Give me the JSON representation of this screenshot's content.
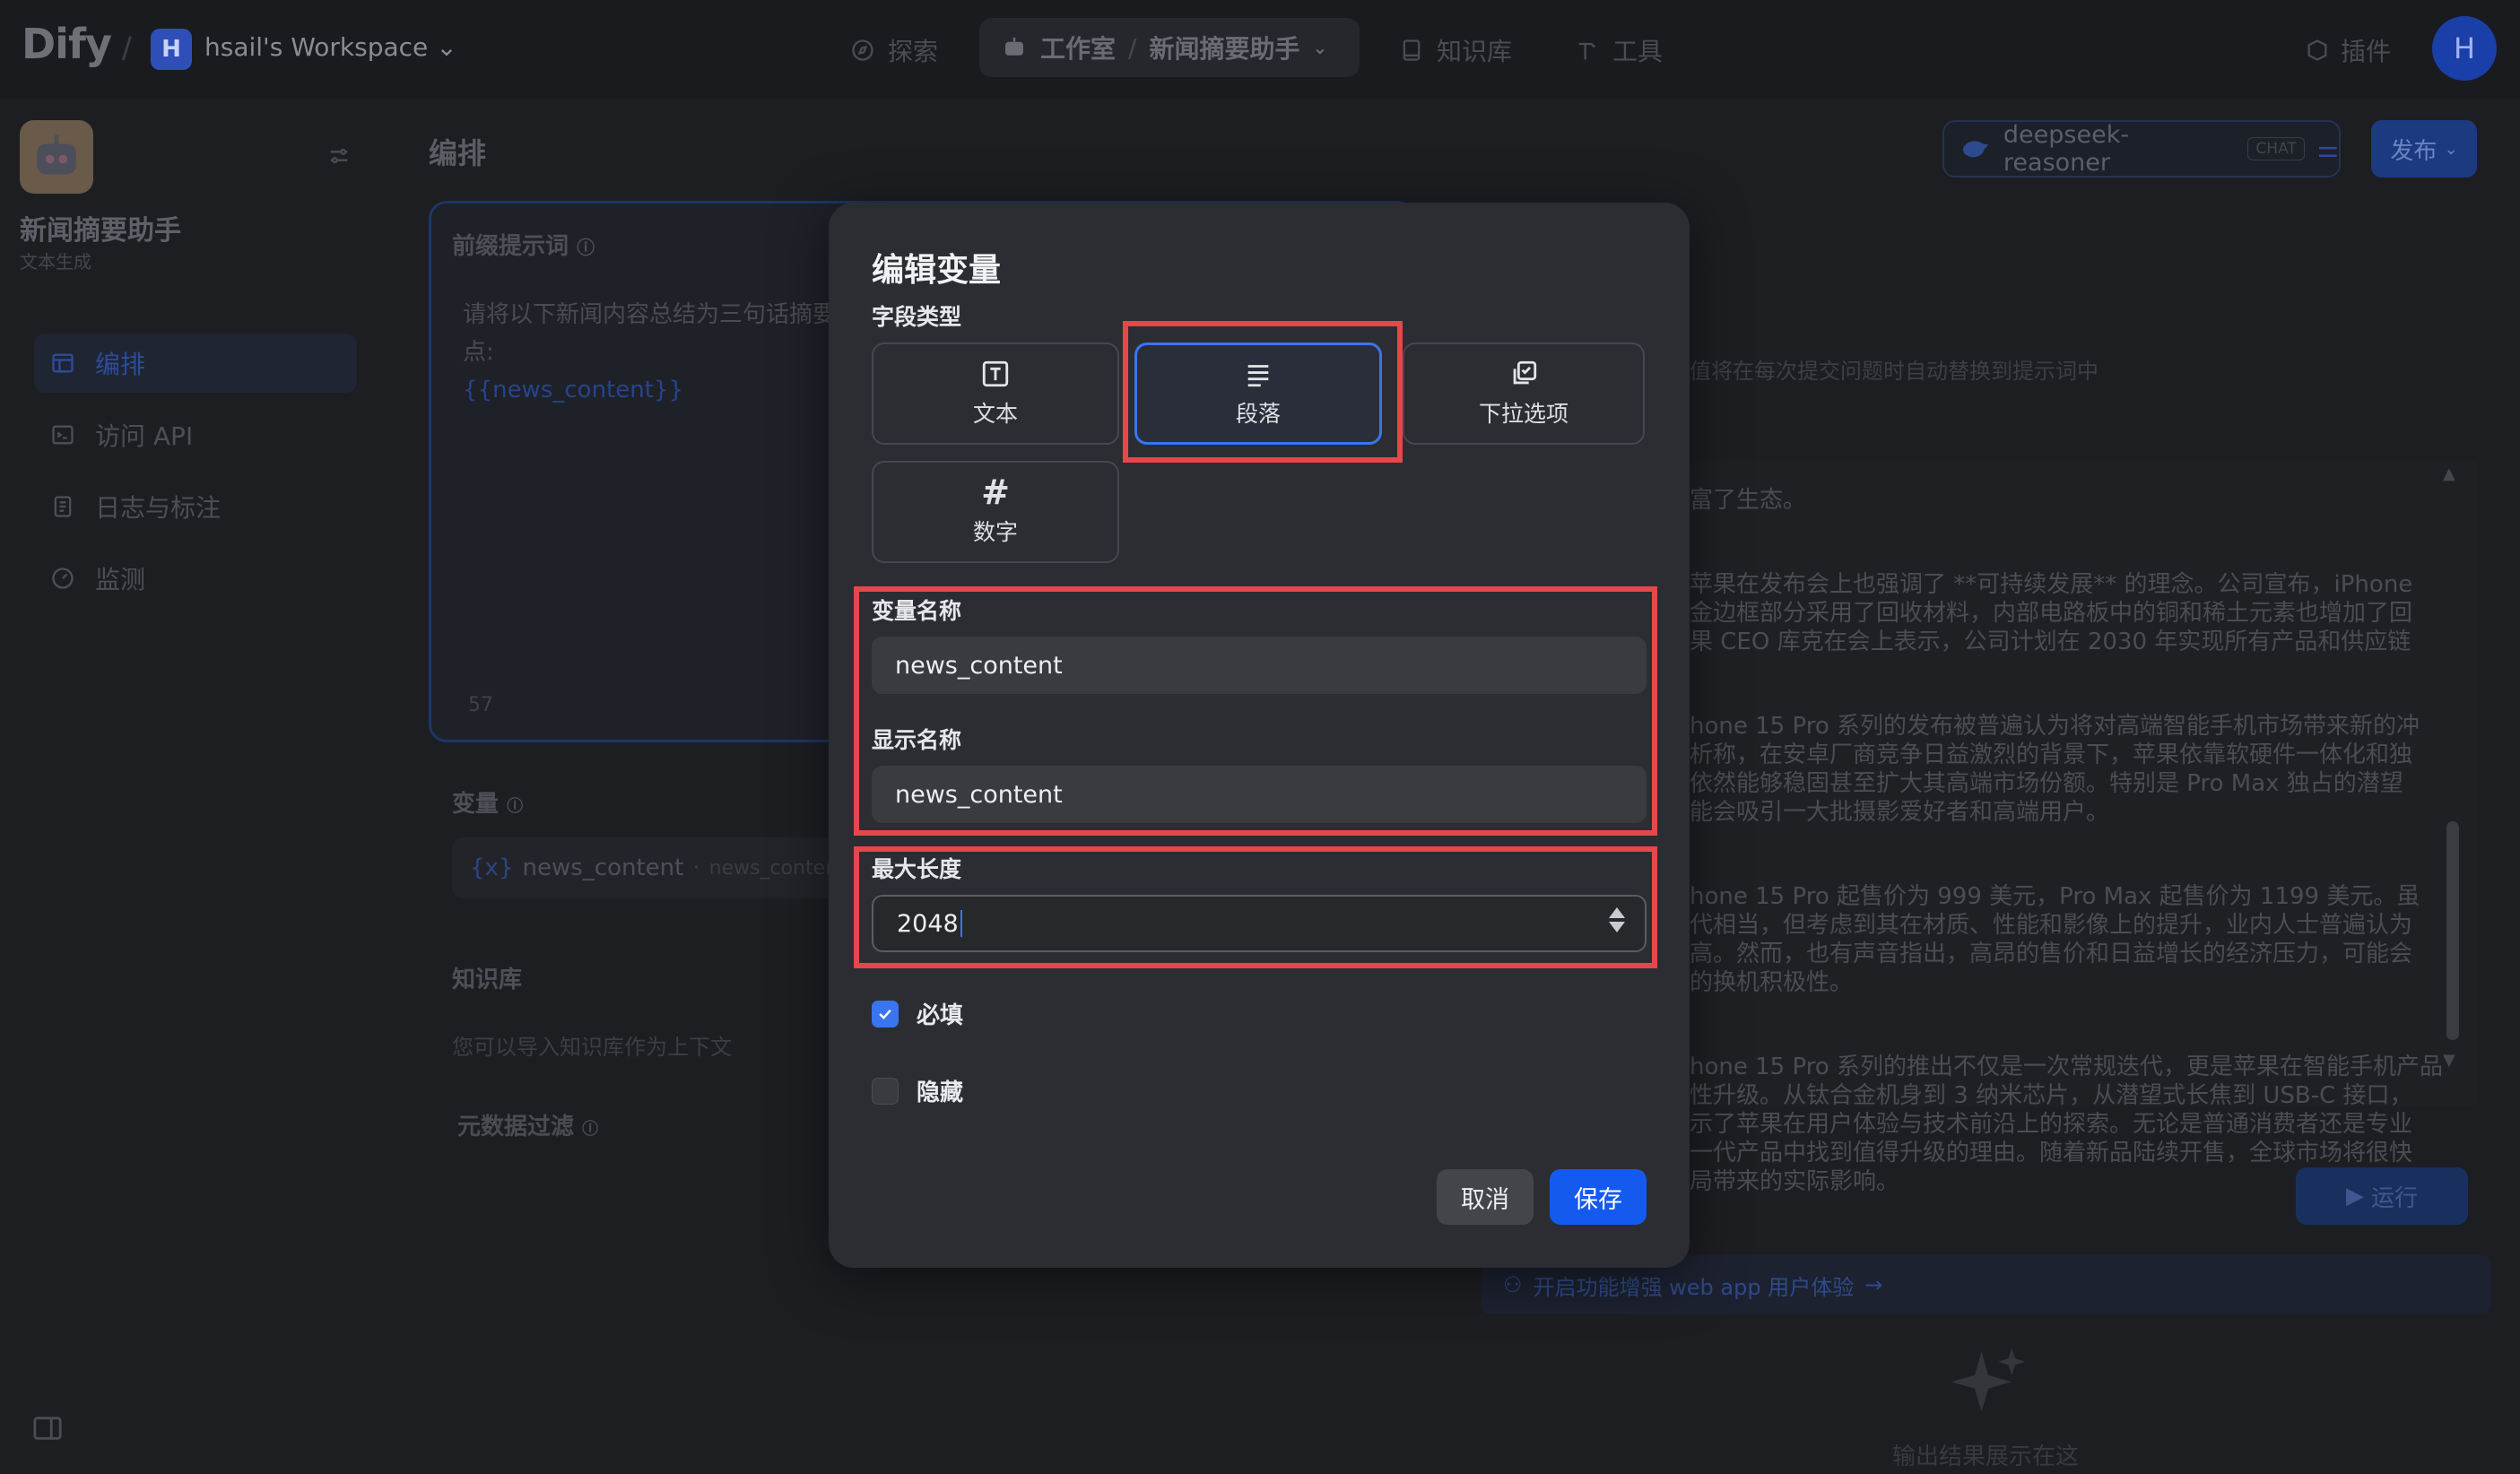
{
  "topbar": {
    "logo": "Dify",
    "workspace_initial": "H",
    "workspace_name": "hsail's Workspace",
    "nav_explore": "探索",
    "nav_studio": "工作室",
    "nav_app": "新闻摘要助手",
    "nav_knowledge": "知识库",
    "nav_tools": "工具",
    "nav_plugins": "插件",
    "user_initial": "H"
  },
  "sidebar": {
    "app_name": "新闻摘要助手",
    "app_type": "文本生成",
    "items": [
      {
        "label": "编排",
        "active": true
      },
      {
        "label": "访问 API"
      },
      {
        "label": "日志与标注"
      },
      {
        "label": "监测"
      }
    ]
  },
  "main": {
    "section_title": "编排",
    "prompt_header": "前缀提示词",
    "prompt_line1": "请将以下新闻内容总结为三句话摘要",
    "prompt_line2": "点:",
    "prompt_var": "{{news_content}}",
    "char_count": "57",
    "variables_header": "变量",
    "variable_key": "news_content",
    "variable_name": "news_content",
    "knowledge_header": "知识库",
    "knowledge_desc": "您可以导入知识库作为上下文",
    "metadata_header": "元数据过滤"
  },
  "right": {
    "model_name": "deepseek-reasoner",
    "model_tag": "CHAT",
    "publish_label": "发布",
    "var_hint": "值将在每次提交问题时自动替换到提示词中",
    "news_paragraphs": [
      "富了生态。",
      "苹果在发布会上也强调了 **可持续发展** 的理念。公司宣布，iPhone\n金边框部分采用了回收材料，内部电路板中的铜和稀土元素也增加了回\n果 CEO 库克在会上表示，公司计划在 2030 年实现所有产品和供应链",
      "hone 15 Pro 系列的发布被普遍认为将对高端智能手机市场带来新的冲\n析称，在安卓厂商竞争日益激烈的背景下，苹果依靠软硬件一体化和独\n依然能够稳固甚至扩大其高端市场份额。特别是 Pro Max 独占的潜望\n能会吸引一大批摄影爱好者和高端用户。",
      "hone 15 Pro 起售价为 999 美元，Pro Max 起售价为 1199 美元。虽\n代相当，但考虑到其在材质、性能和影像上的提升，业内人士普遍认为\n高。然而，也有声音指出，高昂的售价和日益增长的经济压力，可能会\n的换机积极性。",
      "hone 15 Pro 系列的推出不仅是一次常规迭代，更是苹果在智能手机产品\n性升级。从钛合金机身到 3 纳米芯片，从潜望式长焦到 USB-C 接口，\n示了苹果在用户体验与技术前沿上的探索。无论是普通消费者还是专业\n一代产品中找到值得升级的理由。随着新品陆续开售，全球市场将很快\n局带来的实际影响。"
    ],
    "run_label": "运行",
    "banner_text": "开启功能增强 web app 用户体验",
    "result_hint": "输出结果展示在这"
  },
  "modal": {
    "title": "编辑变量",
    "field_type_label": "字段类型",
    "types": [
      {
        "label": "文本",
        "icon": "text-type-icon"
      },
      {
        "label": "段落",
        "icon": "paragraph-icon",
        "selected": true
      },
      {
        "label": "下拉选项",
        "icon": "select-icon"
      },
      {
        "label": "数字",
        "icon": "hash-icon"
      }
    ],
    "var_name_label": "变量名称",
    "var_name_value": "news_content",
    "display_name_label": "显示名称",
    "display_name_value": "news_content",
    "max_length_label": "最大长度",
    "max_length_value": "2048",
    "required_label": "必填",
    "required_checked": true,
    "hidden_label": "隐藏",
    "hidden_checked": false,
    "cancel_label": "取消",
    "save_label": "保存"
  },
  "colors": {
    "accent": "#155aef",
    "highlight": "#e5474b",
    "modal_bg": "#2c2d32"
  }
}
